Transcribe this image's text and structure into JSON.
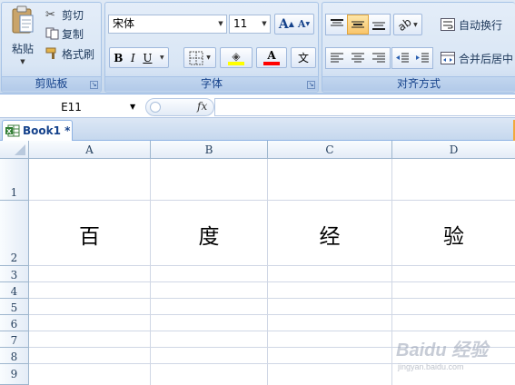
{
  "clipboard": {
    "paste_label": "粘贴",
    "cut_label": "剪切",
    "copy_label": "复制",
    "format_painter_label": "格式刷",
    "group_label": "剪贴板"
  },
  "font": {
    "font_name": "宋体",
    "font_size": "11",
    "grow_label": "A",
    "shrink_label": "A",
    "bold_label": "B",
    "italic_label": "I",
    "underline_label": "U",
    "phonetic_label": "文",
    "group_label": "字体",
    "highlight_color": "#ffff00",
    "font_color": "#ff0000"
  },
  "alignment": {
    "wrap_text_label": "自动换行",
    "merge_center_label": "合并后居中",
    "group_label": "对齐方式"
  },
  "formula_bar": {
    "name_box": "E11",
    "fx_label": "fx",
    "formula": ""
  },
  "workbook_tab": {
    "label": "Book1 *"
  },
  "sheet": {
    "columns": [
      "A",
      "B",
      "C",
      "D"
    ],
    "rows": [
      "1",
      "2",
      "3",
      "4",
      "5",
      "6",
      "7",
      "8",
      "9"
    ],
    "row2_values": [
      "百",
      "度",
      "经",
      "验"
    ]
  },
  "watermark": {
    "text": "Baidu 经验",
    "url": "jingyan.baidu.com"
  },
  "colors": {
    "ribbon_bg": "#d3e1f1",
    "grid_line": "#d0d7e5",
    "header_text": "#27415f",
    "accent": "#15428b"
  }
}
